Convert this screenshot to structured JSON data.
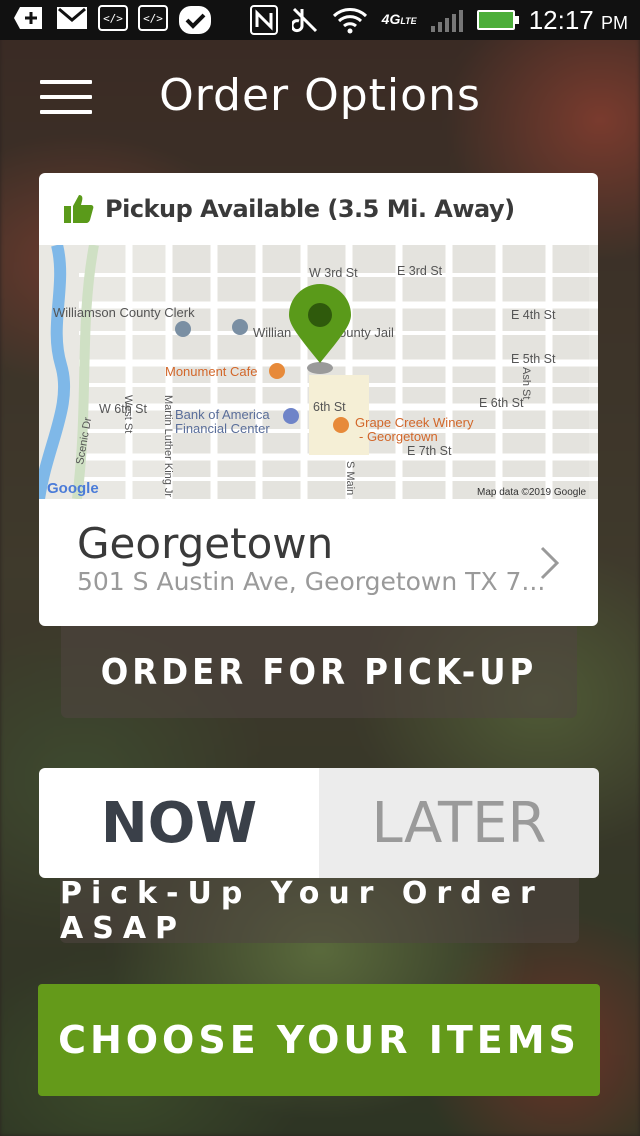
{
  "status_bar": {
    "time": "12:17",
    "ampm": "PM",
    "network": "4G",
    "network_sub": "LTE",
    "icons": [
      "plus-icon",
      "mail-icon",
      "code-icon",
      "code-icon",
      "check-bubble-icon",
      "nfc-icon",
      "mute-icon",
      "wifi-icon",
      "signal-icon",
      "battery-icon"
    ]
  },
  "header": {
    "title": "Order Options",
    "menu_icon": "hamburger-icon"
  },
  "location_card": {
    "pickup_status": "Pickup Available (3.5 Mi. Away)",
    "status_icon": "thumbs-up-icon",
    "map": {
      "labels": {
        "clerk": "Williamson County Clerk",
        "jail_a": "Willian",
        "jail_b": "ounty Jail",
        "cafe": "Monument Cafe",
        "bank1": "Bank of America",
        "bank2": "Financial Center",
        "winery1": "Grape Creek Winery",
        "winery2": "- Georgetown",
        "w3rd": "W 3rd St",
        "e3rd": "E 3rd St",
        "e4th": "E 4th St",
        "e5th": "E 5th St",
        "w6th": "W 6th St",
        "s6th": "6th St",
        "e6th": "E 6th St",
        "e7th": "E 7th St",
        "west": "West St",
        "mlk": "Martin Luther King Jr St",
        "scenic": "Scenic Dr",
        "main": "S Main S",
        "ash": "Ash St",
        "google": "Google",
        "attribution": "Map data ©2019 Google"
      }
    },
    "location_name": "Georgetown",
    "address": "501 S Austin Ave, Georgetown TX 7..."
  },
  "order_type_button": "ORDER FOR PICK-UP",
  "timing_toggle": {
    "now_label": "NOW",
    "later_label": "LATER",
    "selected": "NOW"
  },
  "timing_caption": "Pick-Up Your Order ASAP",
  "choose_button": "CHOOSE YOUR ITEMS",
  "colors": {
    "accent_green": "#649a1a",
    "pin_green": "#5a9a1a"
  }
}
